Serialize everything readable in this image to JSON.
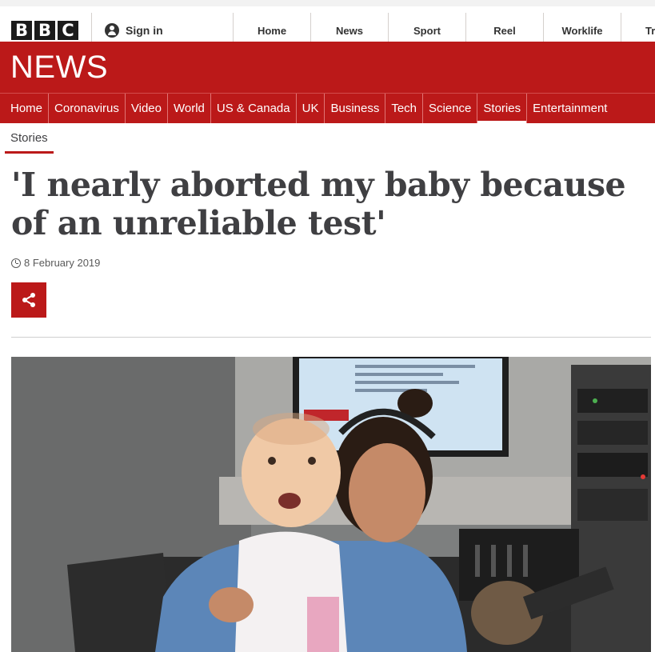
{
  "masthead": {
    "logo_letters": [
      "B",
      "B",
      "C"
    ],
    "signin_label": "Sign in",
    "nav": [
      "Home",
      "News",
      "Sport",
      "Reel",
      "Worklife",
      "Tra"
    ]
  },
  "news_band": {
    "wordmark": "NEWS"
  },
  "subnav": {
    "items": [
      "Home",
      "Coronavirus",
      "Video",
      "World",
      "US & Canada",
      "UK",
      "Business",
      "Tech",
      "Science",
      "Stories",
      "Entertainment"
    ],
    "active": "Stories"
  },
  "section": {
    "label": "Stories"
  },
  "article": {
    "headline": "'I nearly aborted my baby because of an unreliable test'",
    "date": "8 February 2019",
    "share_icon": "share-icon"
  },
  "colors": {
    "brand_red": "#bb1919",
    "text": "#3f3f42"
  }
}
